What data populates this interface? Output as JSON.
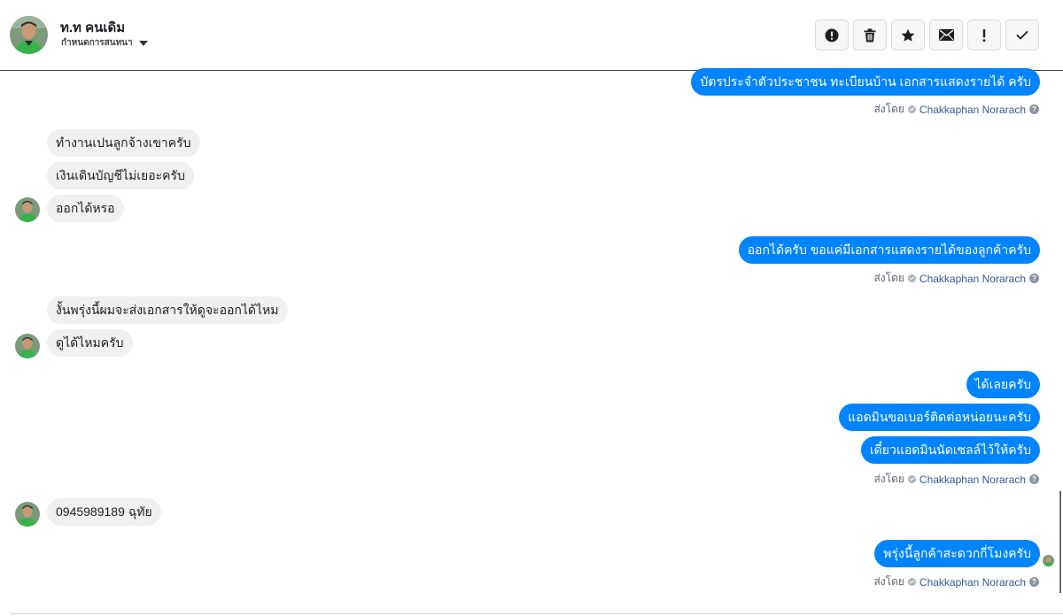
{
  "header": {
    "contact_name": "ท.ท คนเดิม",
    "subtitle": "กำหนดการสนทนา",
    "toolbar": [
      {
        "name": "report-icon",
        "label": "Report"
      },
      {
        "name": "trash-icon",
        "label": "Delete"
      },
      {
        "name": "star-icon",
        "label": "Star"
      },
      {
        "name": "envelope-icon",
        "label": "Mark unread"
      },
      {
        "name": "exclamation-icon",
        "label": "Important"
      },
      {
        "name": "checkmark-icon",
        "label": "Done"
      }
    ]
  },
  "messages": {
    "m1": "บัตรประจำตัวประชาชน ทะเบียนบ้าน เอกสารแสดงรายได้ ครับ",
    "m2": "ทำงานเปนลูกจ้างเขาครับ",
    "m3": "เงินเดินบัญชีไม่เยอะครับ",
    "m4": "ออกได้หรอ",
    "m5": "ออกได้ครับ ขอแค่มีเอกสารแสดงรายได้ของลูกค้าครับ",
    "m6": "งั้นพรุ่งนี้ผมจะส่งเอกสารให้ดูจะออกได้ไหม",
    "m7": "ดูได้ไหมครับ",
    "m8": "ได้เลยครับ",
    "m9": "แอดมินขอเบอร์ติดต่อหน่อยนะครับ",
    "m10": "เดี๋ยวแอดมินนัดเซลล์ไว้ให้ครับ",
    "m11": "0945989189 ฉุทัย",
    "m12": "พรุ่งนี้ลูกค้าสะดวกกี่โมงครับ"
  },
  "sent_by": {
    "prefix": "ส่งโดย",
    "sender": "Chakkaphan Norarach"
  },
  "colors": {
    "outgoing_bubble": "#0084ff",
    "incoming_bubble": "#f1f0f0",
    "sender_link": "#385898"
  }
}
